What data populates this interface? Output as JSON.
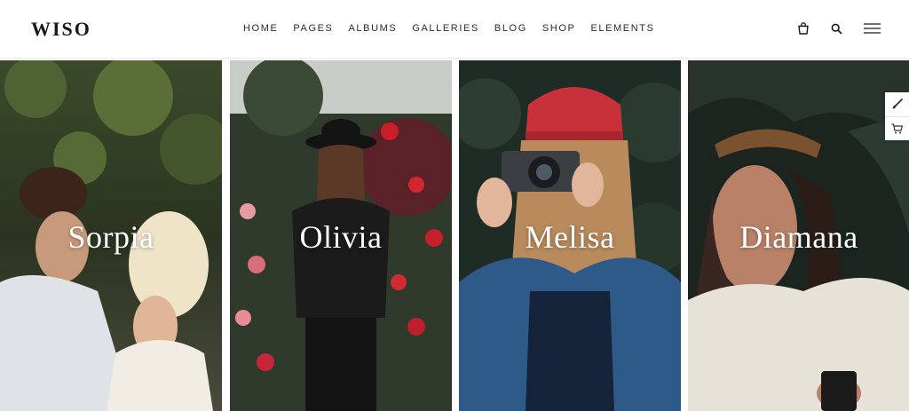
{
  "header": {
    "logo": "WISO",
    "nav": [
      {
        "label": "HOME"
      },
      {
        "label": "PAGES"
      },
      {
        "label": "ALBUMS"
      },
      {
        "label": "GALLERIES"
      },
      {
        "label": "BLOG"
      },
      {
        "label": "SHOP"
      },
      {
        "label": "ELEMENTS"
      }
    ],
    "icons": [
      "shopping-bag-icon",
      "search-icon",
      "hamburger-menu-icon"
    ]
  },
  "gallery": {
    "panels": [
      {
        "name": "Sorpia"
      },
      {
        "name": "Olivia"
      },
      {
        "name": "Melisa"
      },
      {
        "name": "Diamana"
      }
    ]
  },
  "side_tools": [
    "brush-icon",
    "cart-icon"
  ],
  "colors": {
    "text_dark": "#1a1a1a",
    "nav_text": "#2b2b2b",
    "overlay_text": "#ffffff"
  }
}
